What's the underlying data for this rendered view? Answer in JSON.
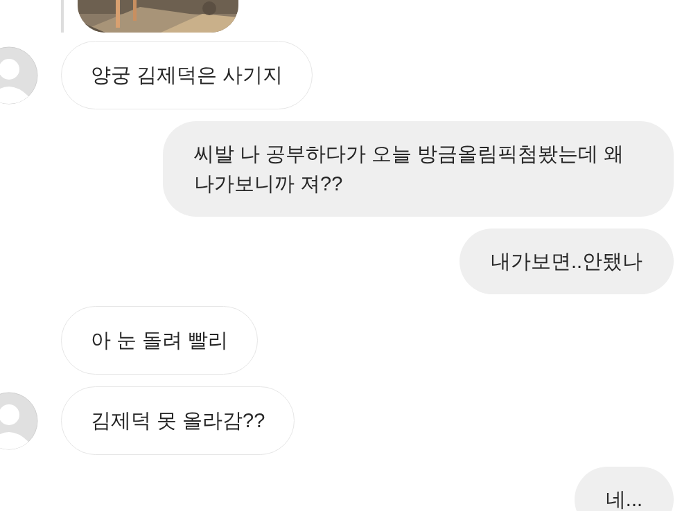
{
  "messages": [
    {
      "kind": "incoming",
      "show_avatar": true,
      "text": "양궁 김제덕은 사기지"
    },
    {
      "kind": "outgoing",
      "text": "씨발 나 공부하다가 오늘 방금올림픽첨봤는데 왜 나가보니까 져??"
    },
    {
      "kind": "outgoing",
      "text": "내가보면..안됐나"
    },
    {
      "kind": "incoming",
      "show_avatar": false,
      "text": "아 눈 돌려 빨리"
    },
    {
      "kind": "incoming",
      "show_avatar": true,
      "text": "김제덕 못 올라감??"
    },
    {
      "kind": "outgoing",
      "text": "네..."
    }
  ]
}
